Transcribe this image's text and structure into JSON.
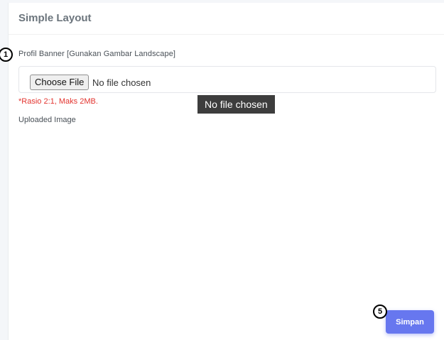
{
  "card": {
    "title": "Simple Layout"
  },
  "form": {
    "banner_label": "Profil Banner [Gunakan Gambar Landscape]",
    "choose_file_label": "Choose File",
    "file_status": "No file chosen",
    "hint": "*Rasio 2:1, Maks 2MB.",
    "uploaded_label": "Uploaded Image"
  },
  "tooltip": {
    "text": "No file chosen"
  },
  "markers": {
    "first": "1",
    "second": "5"
  },
  "actions": {
    "save_label": "Simpan"
  },
  "colors": {
    "accent": "#6777ef",
    "hint": "#e3342f",
    "title": "#6c757d"
  }
}
